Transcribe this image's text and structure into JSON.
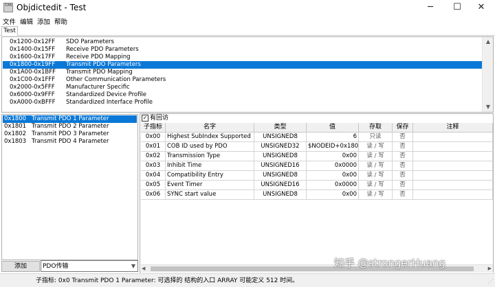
{
  "window": {
    "app_icon_text": "CAN",
    "title": "Objdictedit - Test",
    "minimize_glyph": "─",
    "maximize_glyph": "☐",
    "close_glyph": "✕"
  },
  "menu": [
    "文件",
    "编辑",
    "添加",
    "帮助"
  ],
  "tabs": [
    {
      "label": "Test",
      "active": true
    }
  ],
  "index_ranges": [
    {
      "range": "0x1200-0x12FF",
      "name": "SDO Parameters",
      "selected": false
    },
    {
      "range": "0x1400-0x15FF",
      "name": "Receive PDO Parameters",
      "selected": false
    },
    {
      "range": "0x1600-0x17FF",
      "name": "Receive PDO Mapping",
      "selected": false
    },
    {
      "range": "0x1800-0x19FF",
      "name": "Transmit PDO Parameters",
      "selected": true
    },
    {
      "range": "0x1A00-0x1BFF",
      "name": "Transmit PDO Mapping",
      "selected": false
    },
    {
      "range": "0x1C00-0x1FFF",
      "name": "Other Communication Parameters",
      "selected": false
    },
    {
      "range": "0x2000-0x5FFF",
      "name": "Manufacturer Specific",
      "selected": false
    },
    {
      "range": "0x6000-0x9FFF",
      "name": "Standardized Device Profile",
      "selected": false
    },
    {
      "range": "0xA000-0xBFFF",
      "name": "Standardized Interface Profile",
      "selected": false
    }
  ],
  "objects": [
    {
      "index": "0x1800",
      "name": "Transmit PDO 1 Parameter",
      "selected": true
    },
    {
      "index": "0x1801",
      "name": "Transmit PDO 2 Parameter",
      "selected": false
    },
    {
      "index": "0x1802",
      "name": "Transmit PDO 3 Parameter",
      "selected": false
    },
    {
      "index": "0x1803",
      "name": "Transmit PDO 4 Parameter",
      "selected": false
    }
  ],
  "add_button": "添加",
  "pdo_select": {
    "value": "PDO传输"
  },
  "checkbox": {
    "label": "有回访",
    "checked": true
  },
  "grid": {
    "headers": [
      "子指标",
      "名字",
      "类型",
      "值",
      "存取",
      "保存",
      "注释"
    ],
    "rows": [
      [
        "0x00",
        "Highest SubIndex Supported",
        "UNSIGNED8",
        "6",
        "只读",
        "否",
        ""
      ],
      [
        "0x01",
        "COB ID used by PDO",
        "UNSIGNED32",
        "$NODEID+0x180",
        "读 / 写",
        "否",
        ""
      ],
      [
        "0x02",
        "Transmission Type",
        "UNSIGNED8",
        "0x00",
        "读 / 写",
        "否",
        ""
      ],
      [
        "0x03",
        "Inhibit Time",
        "UNSIGNED16",
        "0x0000",
        "读 / 写",
        "否",
        ""
      ],
      [
        "0x04",
        "Compatibility Entry",
        "UNSIGNED8",
        "0x00",
        "读 / 写",
        "否",
        ""
      ],
      [
        "0x05",
        "Event Timer",
        "UNSIGNED16",
        "0x0000",
        "读 / 写",
        "否",
        ""
      ],
      [
        "0x06",
        "SYNC start value",
        "UNSIGNED8",
        "0x00",
        "读 / 写",
        "否",
        ""
      ]
    ]
  },
  "status": "子指标:   0x0 Transmit PDO 1 Parameter:   可选择的 结构的入口 ARRAY 可能定义 512 时间。",
  "watermark": "知乎 @strongerHuang"
}
